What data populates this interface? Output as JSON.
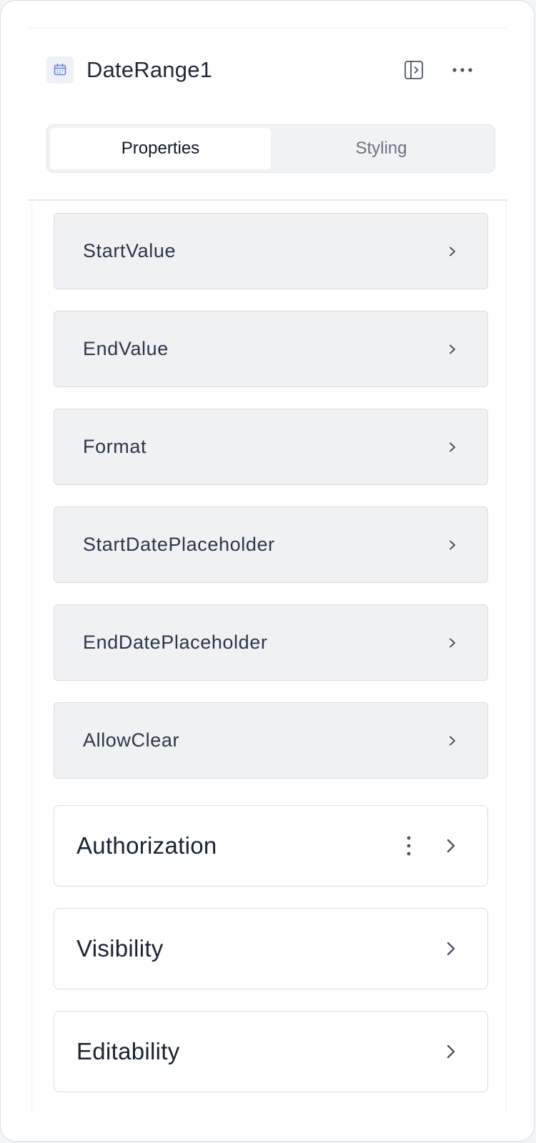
{
  "header": {
    "component_name": "DateRange1",
    "component_icon": "calendar-icon",
    "panel_toggle_icon": "panel-collapse-icon",
    "more_icon": "more-horizontal-icon"
  },
  "tabs": [
    {
      "label": "Properties",
      "active": true
    },
    {
      "label": "Styling",
      "active": false
    }
  ],
  "properties": [
    {
      "label": "StartValue"
    },
    {
      "label": "EndValue"
    },
    {
      "label": "Format"
    },
    {
      "label": "StartDatePlaceholder"
    },
    {
      "label": "EndDatePlaceholder"
    },
    {
      "label": "AllowClear"
    }
  ],
  "sections": [
    {
      "label": "Authorization",
      "has_menu": true
    },
    {
      "label": "Visibility",
      "has_menu": false
    },
    {
      "label": "Editability",
      "has_menu": false
    }
  ],
  "colors": {
    "accent_icon": "#6b85e0",
    "row_background": "#f0f1f3",
    "border": "#d9dce1"
  }
}
